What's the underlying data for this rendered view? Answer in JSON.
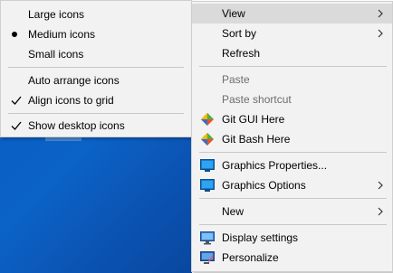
{
  "view_submenu": {
    "items": [
      {
        "label": "Large icons"
      },
      {
        "label": "Medium icons"
      },
      {
        "label": "Small icons"
      },
      {
        "label": "Auto arrange icons"
      },
      {
        "label": "Align icons to grid"
      },
      {
        "label": "Show desktop icons"
      }
    ]
  },
  "context_menu": {
    "items": [
      {
        "label": "View"
      },
      {
        "label": "Sort by"
      },
      {
        "label": "Refresh"
      },
      {
        "label": "Paste"
      },
      {
        "label": "Paste shortcut"
      },
      {
        "label": "Git GUI Here"
      },
      {
        "label": "Git Bash Here"
      },
      {
        "label": "Graphics Properties..."
      },
      {
        "label": "Graphics Options"
      },
      {
        "label": "New"
      },
      {
        "label": "Display settings"
      },
      {
        "label": "Personalize"
      }
    ]
  },
  "icons": {
    "git": "git-diamond-icon",
    "graphics": "intel-graphics-icon",
    "display": "monitor-icon",
    "personalize": "personalize-icon",
    "check": "check-icon",
    "bullet": "radio-bullet-icon",
    "chevron": "chevron-right-icon"
  },
  "colors": {
    "menu_bg": "#f2f2f2",
    "highlight": "#dadada",
    "disabled_text": "#6d6d6d",
    "desktop_blue": "#0b5fc4"
  }
}
